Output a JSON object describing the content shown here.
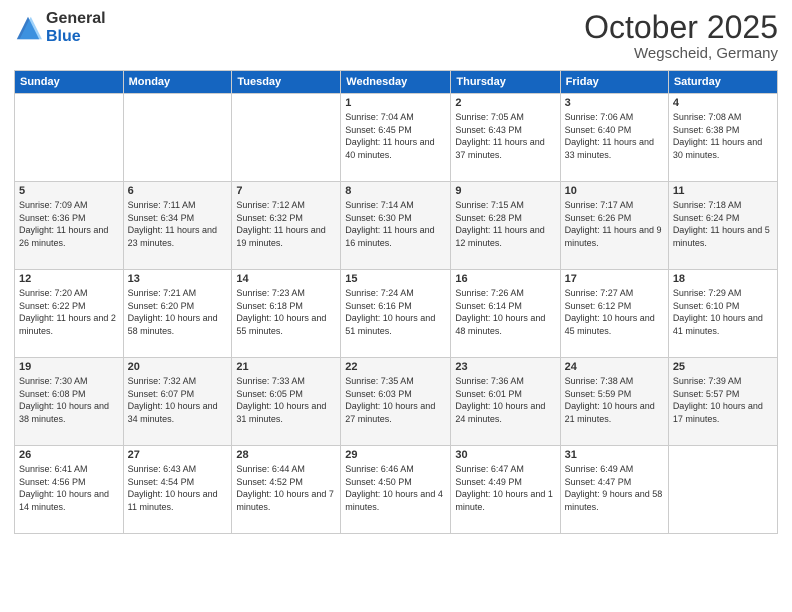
{
  "logo": {
    "general": "General",
    "blue": "Blue"
  },
  "header": {
    "month": "October 2025",
    "location": "Wegscheid, Germany"
  },
  "days_of_week": [
    "Sunday",
    "Monday",
    "Tuesday",
    "Wednesday",
    "Thursday",
    "Friday",
    "Saturday"
  ],
  "weeks": [
    [
      {
        "day": "",
        "info": ""
      },
      {
        "day": "",
        "info": ""
      },
      {
        "day": "",
        "info": ""
      },
      {
        "day": "1",
        "info": "Sunrise: 7:04 AM\nSunset: 6:45 PM\nDaylight: 11 hours and 40 minutes."
      },
      {
        "day": "2",
        "info": "Sunrise: 7:05 AM\nSunset: 6:43 PM\nDaylight: 11 hours and 37 minutes."
      },
      {
        "day": "3",
        "info": "Sunrise: 7:06 AM\nSunset: 6:40 PM\nDaylight: 11 hours and 33 minutes."
      },
      {
        "day": "4",
        "info": "Sunrise: 7:08 AM\nSunset: 6:38 PM\nDaylight: 11 hours and 30 minutes."
      }
    ],
    [
      {
        "day": "5",
        "info": "Sunrise: 7:09 AM\nSunset: 6:36 PM\nDaylight: 11 hours and 26 minutes."
      },
      {
        "day": "6",
        "info": "Sunrise: 7:11 AM\nSunset: 6:34 PM\nDaylight: 11 hours and 23 minutes."
      },
      {
        "day": "7",
        "info": "Sunrise: 7:12 AM\nSunset: 6:32 PM\nDaylight: 11 hours and 19 minutes."
      },
      {
        "day": "8",
        "info": "Sunrise: 7:14 AM\nSunset: 6:30 PM\nDaylight: 11 hours and 16 minutes."
      },
      {
        "day": "9",
        "info": "Sunrise: 7:15 AM\nSunset: 6:28 PM\nDaylight: 11 hours and 12 minutes."
      },
      {
        "day": "10",
        "info": "Sunrise: 7:17 AM\nSunset: 6:26 PM\nDaylight: 11 hours and 9 minutes."
      },
      {
        "day": "11",
        "info": "Sunrise: 7:18 AM\nSunset: 6:24 PM\nDaylight: 11 hours and 5 minutes."
      }
    ],
    [
      {
        "day": "12",
        "info": "Sunrise: 7:20 AM\nSunset: 6:22 PM\nDaylight: 11 hours and 2 minutes."
      },
      {
        "day": "13",
        "info": "Sunrise: 7:21 AM\nSunset: 6:20 PM\nDaylight: 10 hours and 58 minutes."
      },
      {
        "day": "14",
        "info": "Sunrise: 7:23 AM\nSunset: 6:18 PM\nDaylight: 10 hours and 55 minutes."
      },
      {
        "day": "15",
        "info": "Sunrise: 7:24 AM\nSunset: 6:16 PM\nDaylight: 10 hours and 51 minutes."
      },
      {
        "day": "16",
        "info": "Sunrise: 7:26 AM\nSunset: 6:14 PM\nDaylight: 10 hours and 48 minutes."
      },
      {
        "day": "17",
        "info": "Sunrise: 7:27 AM\nSunset: 6:12 PM\nDaylight: 10 hours and 45 minutes."
      },
      {
        "day": "18",
        "info": "Sunrise: 7:29 AM\nSunset: 6:10 PM\nDaylight: 10 hours and 41 minutes."
      }
    ],
    [
      {
        "day": "19",
        "info": "Sunrise: 7:30 AM\nSunset: 6:08 PM\nDaylight: 10 hours and 38 minutes."
      },
      {
        "day": "20",
        "info": "Sunrise: 7:32 AM\nSunset: 6:07 PM\nDaylight: 10 hours and 34 minutes."
      },
      {
        "day": "21",
        "info": "Sunrise: 7:33 AM\nSunset: 6:05 PM\nDaylight: 10 hours and 31 minutes."
      },
      {
        "day": "22",
        "info": "Sunrise: 7:35 AM\nSunset: 6:03 PM\nDaylight: 10 hours and 27 minutes."
      },
      {
        "day": "23",
        "info": "Sunrise: 7:36 AM\nSunset: 6:01 PM\nDaylight: 10 hours and 24 minutes."
      },
      {
        "day": "24",
        "info": "Sunrise: 7:38 AM\nSunset: 5:59 PM\nDaylight: 10 hours and 21 minutes."
      },
      {
        "day": "25",
        "info": "Sunrise: 7:39 AM\nSunset: 5:57 PM\nDaylight: 10 hours and 17 minutes."
      }
    ],
    [
      {
        "day": "26",
        "info": "Sunrise: 6:41 AM\nSunset: 4:56 PM\nDaylight: 10 hours and 14 minutes."
      },
      {
        "day": "27",
        "info": "Sunrise: 6:43 AM\nSunset: 4:54 PM\nDaylight: 10 hours and 11 minutes."
      },
      {
        "day": "28",
        "info": "Sunrise: 6:44 AM\nSunset: 4:52 PM\nDaylight: 10 hours and 7 minutes."
      },
      {
        "day": "29",
        "info": "Sunrise: 6:46 AM\nSunset: 4:50 PM\nDaylight: 10 hours and 4 minutes."
      },
      {
        "day": "30",
        "info": "Sunrise: 6:47 AM\nSunset: 4:49 PM\nDaylight: 10 hours and 1 minute."
      },
      {
        "day": "31",
        "info": "Sunrise: 6:49 AM\nSunset: 4:47 PM\nDaylight: 9 hours and 58 minutes."
      },
      {
        "day": "",
        "info": ""
      }
    ]
  ]
}
